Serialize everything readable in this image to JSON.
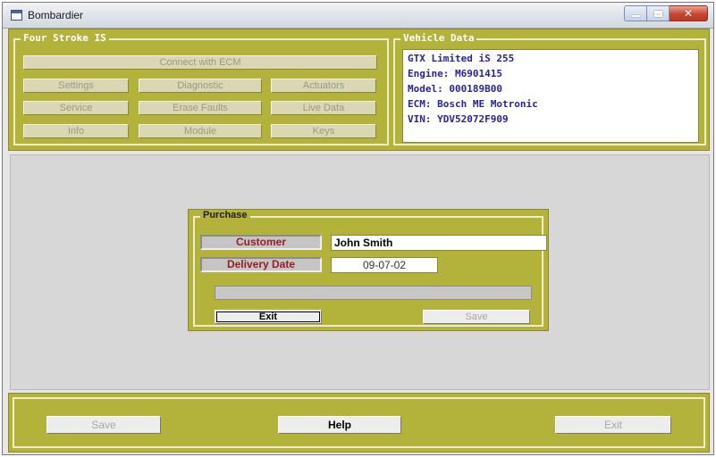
{
  "window": {
    "title": "Bombardier"
  },
  "four_stroke": {
    "legend": "Four Stroke IS",
    "connect_label": "Connect with ECM",
    "buttons": [
      {
        "label": "Settings"
      },
      {
        "label": "Diagnostic"
      },
      {
        "label": "Actuators"
      },
      {
        "label": "Service"
      },
      {
        "label": "Erase Faults"
      },
      {
        "label": "Live Data"
      },
      {
        "label": "Info"
      },
      {
        "label": "Module"
      },
      {
        "label": "Keys"
      }
    ]
  },
  "vehicle": {
    "legend": "Vehicle Data",
    "lines": [
      "GTX Limited iS 255",
      "Engine: M6901415",
      "Model: 000189B00",
      "ECM: Bosch ME Motronic",
      "VIN: YDV52072F909"
    ]
  },
  "purchase": {
    "legend": "Purchase",
    "customer_label": "Customer",
    "customer_value": "John Smith",
    "delivery_label": "Delivery Date",
    "delivery_value": "09-07-02",
    "progress": 0,
    "exit_label": "Exit",
    "save_label": "Save"
  },
  "bottom": {
    "save_label": "Save",
    "help_label": "Help",
    "exit_label": "Exit"
  },
  "colors": {
    "panel": "#b3b23a",
    "vehicle_text": "#27239a",
    "label_text": "#9b1c22"
  }
}
